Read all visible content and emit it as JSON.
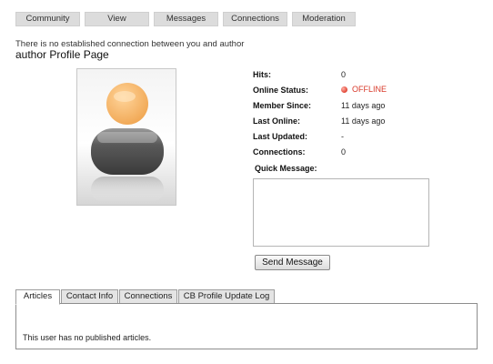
{
  "menu": {
    "items": [
      {
        "label": "Community"
      },
      {
        "label": "View"
      },
      {
        "label": "Messages"
      },
      {
        "label": "Connections"
      },
      {
        "label": "Moderation"
      }
    ]
  },
  "notice": "There is no established connection between you and author",
  "page_title": "author Profile Page",
  "avatar": {
    "icon": "default-user-avatar"
  },
  "info": {
    "hits": {
      "label": "Hits:",
      "value": "0"
    },
    "online_status": {
      "label": "Online Status:",
      "value": "OFFLINE",
      "color": "#d8392a"
    },
    "member_since": {
      "label": "Member Since:",
      "value": "11 days ago"
    },
    "last_online": {
      "label": "Last Online:",
      "value": "11 days ago"
    },
    "last_updated": {
      "label": "Last Updated:",
      "value": "-"
    },
    "connections": {
      "label": "Connections:",
      "value": "0"
    }
  },
  "quick_message": {
    "label": "Quick Message:",
    "value": "",
    "send_label": "Send Message"
  },
  "tabs": {
    "items": [
      {
        "label": "Articles"
      },
      {
        "label": "Contact Info"
      },
      {
        "label": "Connections"
      },
      {
        "label": "CB Profile Update Log"
      }
    ],
    "active": "Articles",
    "content": "This user has no published articles."
  }
}
